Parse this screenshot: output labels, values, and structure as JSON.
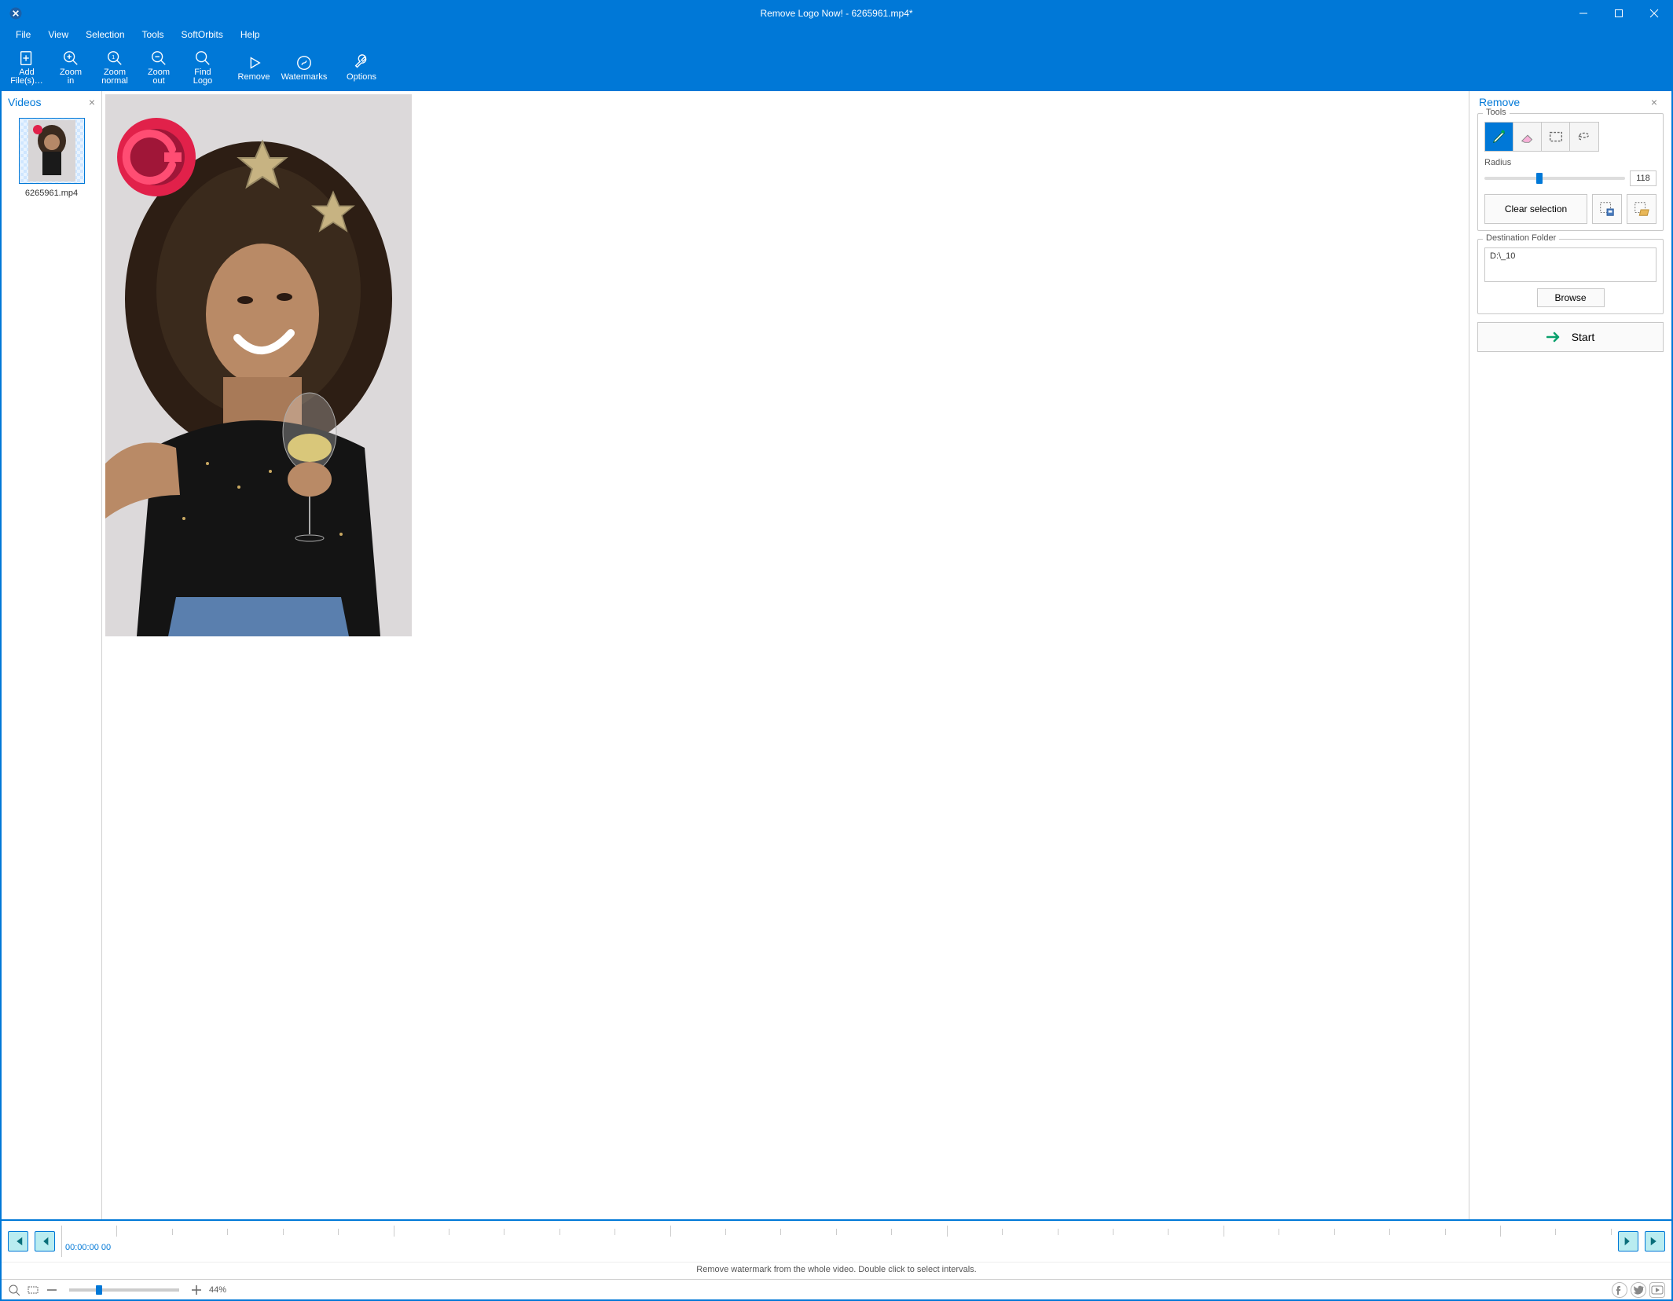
{
  "window": {
    "title": "Remove Logo Now! - 6265961.mp4*"
  },
  "menu": {
    "items": [
      "File",
      "View",
      "Selection",
      "Tools",
      "SoftOrbits",
      "Help"
    ]
  },
  "toolbar": {
    "add_files": "Add\nFile(s)…",
    "zoom_in": "Zoom\nin",
    "zoom_normal": "Zoom\nnormal",
    "zoom_out": "Zoom\nout",
    "find_logo": "Find\nLogo",
    "remove": "Remove",
    "watermarks": "Watermarks",
    "options": "Options"
  },
  "left_panel": {
    "title": "Videos",
    "thumb_name": "6265961.mp4"
  },
  "right_panel": {
    "title": "Remove",
    "tools_label": "Tools",
    "radius_label": "Radius",
    "radius_value": "118",
    "clear_selection": "Clear selection",
    "dest_label": "Destination Folder",
    "dest_path": "D:\\_10",
    "browse": "Browse",
    "start": "Start"
  },
  "timeline": {
    "current": "00:00:00 00",
    "hint": "Remove watermark from the whole video. Double click to select intervals."
  },
  "statusbar": {
    "zoom_pct": "44%"
  }
}
